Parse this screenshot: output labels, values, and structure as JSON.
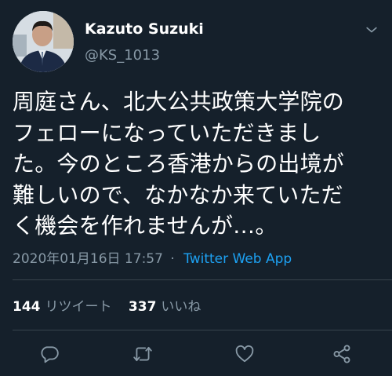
{
  "tweet": {
    "author": {
      "name": "Kazuto Suzuki",
      "handle": "@KS_1013"
    },
    "body_lines": [
      "周庭さん、北大公共政策大学院の",
      "フェローになっていただきまし",
      "た。今のところ香港からの出境が",
      "難しいので、なかなか来ていただ",
      "く機会を作れませんが…。"
    ],
    "timestamp": "2020年01月16日 17:57",
    "separator": "·",
    "source": "Twitter Web App",
    "stats": {
      "retweets_count": "144",
      "retweets_label": "リツイート",
      "likes_count": "337",
      "likes_label": "いいね"
    },
    "icons": {
      "menu": "chevron-down-icon",
      "reply": "reply-icon",
      "retweet": "retweet-icon",
      "like": "heart-icon",
      "share": "share-icon"
    },
    "colors": {
      "background": "#15202b",
      "primary_text": "#ffffff",
      "secondary_text": "#8899a6",
      "link": "#1da1f2",
      "divider": "#38444d"
    }
  }
}
